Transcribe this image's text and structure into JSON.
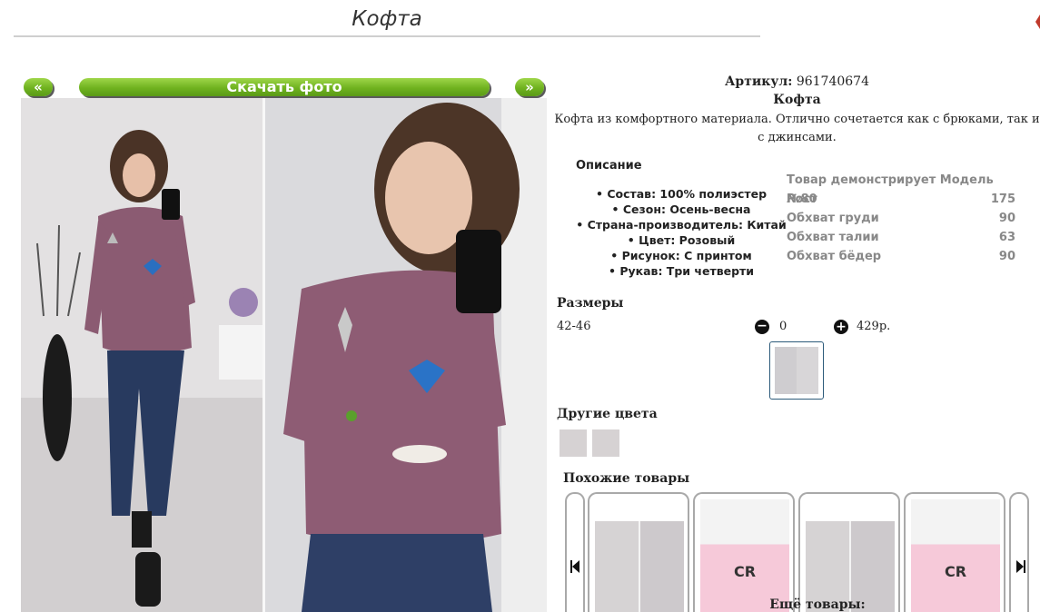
{
  "header": {
    "title": "Кофта"
  },
  "gallery": {
    "prev_label": "«",
    "download_label": "Скачать фото",
    "next_label": "»"
  },
  "product": {
    "sku_label": "Артикул:",
    "sku_value": "961740674",
    "name": "Кофта",
    "description": "Кофта из комфортного материала. Отлично сочетается как с брюками, так и с джинсами."
  },
  "details": {
    "heading": "Описание",
    "attributes": [
      "Состав: 100% полиэстер",
      "Сезон: Осень-весна",
      "Страна-производитель: Китай",
      "Цвет: Розовый",
      "Рисунок: С принтом",
      "Рукав: Три четверти"
    ]
  },
  "model": {
    "heading": "Товар демонстрирует Модель №80",
    "rows": [
      {
        "label": "Рост",
        "value": "175"
      },
      {
        "label": "Обхват груди",
        "value": "90"
      },
      {
        "label": "Обхват талии",
        "value": "63"
      },
      {
        "label": "Обхват бёдер",
        "value": "90"
      }
    ]
  },
  "sizes": {
    "heading": "Размеры",
    "size": "42-46",
    "quantity": "0",
    "price": "429р."
  },
  "colors": {
    "heading": "Другие цвета"
  },
  "similar": {
    "heading": "Похожие товары",
    "card2_text": "CR",
    "card4_text": "CR",
    "more_label": "Ещё товары:"
  }
}
